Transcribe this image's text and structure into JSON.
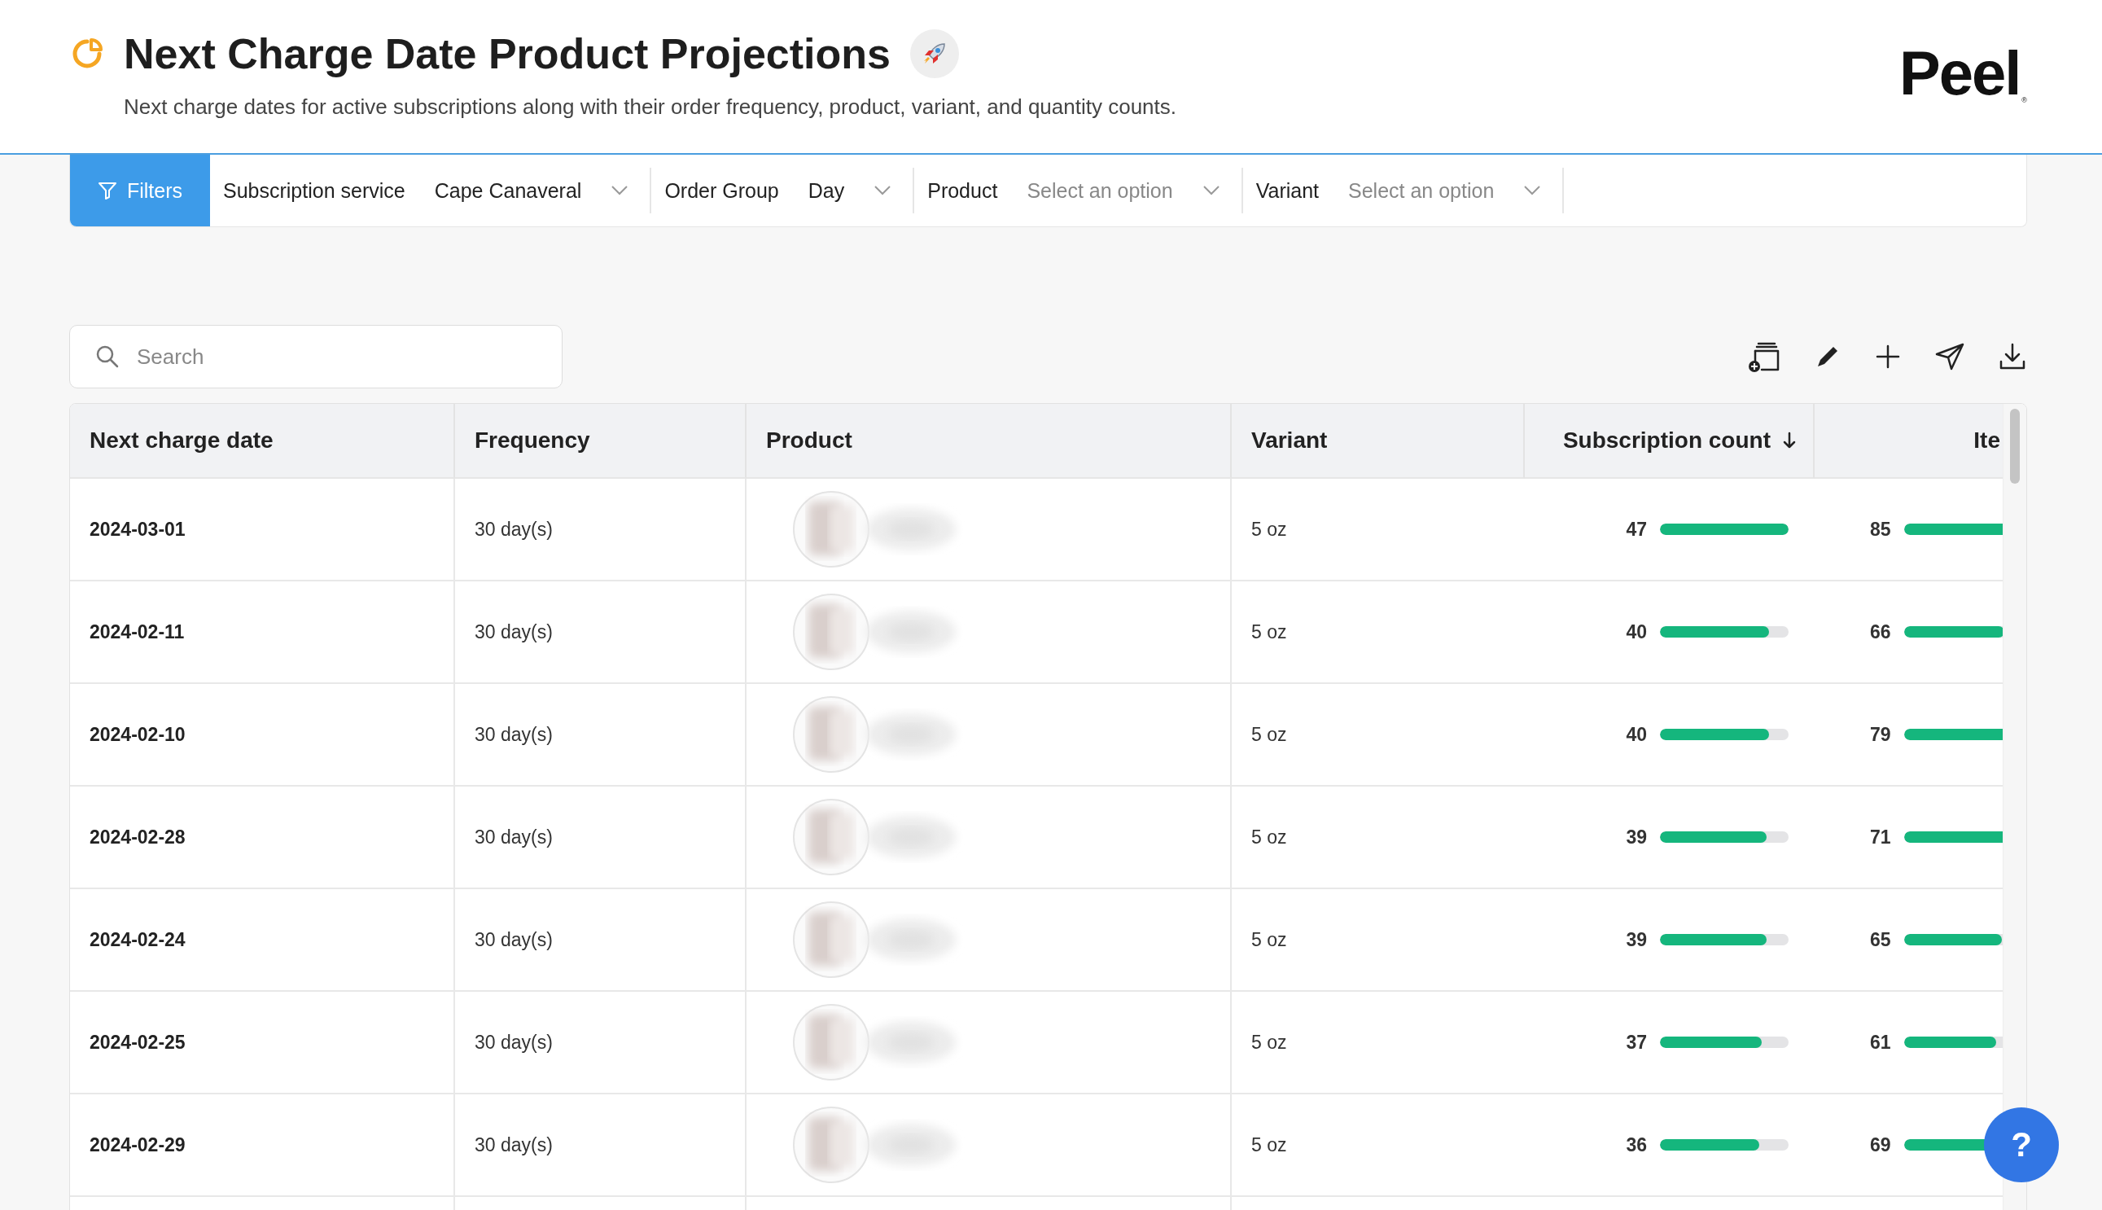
{
  "header": {
    "title": "Next Charge Date Product Projections",
    "subtitle": "Next charge dates for active subscriptions along with their order frequency, product, variant, and quantity counts.",
    "logo": "Peel",
    "logo_mark": "®"
  },
  "filters": {
    "button": "Filters",
    "items": [
      {
        "label": "Subscription service",
        "value": "Cape Canaveral"
      },
      {
        "label": "Order Group",
        "value": "Day"
      },
      {
        "label": "Product",
        "placeholder": "Select an option"
      },
      {
        "label": "Variant",
        "placeholder": "Select an option"
      }
    ]
  },
  "search": {
    "placeholder": "Search"
  },
  "table": {
    "columns": [
      {
        "label": "Next charge date",
        "kind": "text"
      },
      {
        "label": "Frequency",
        "kind": "text"
      },
      {
        "label": "Product",
        "kind": "text"
      },
      {
        "label": "Variant",
        "kind": "text"
      },
      {
        "label": "Subscription count",
        "kind": "text",
        "sort_descending": true
      },
      {
        "label": "Ite",
        "kind": "cut"
      }
    ],
    "rows": [
      {
        "date": "2024-03-01",
        "frequency": "30 day(s)",
        "variant": "5 oz",
        "subscriptions": {
          "value": "47",
          "level": 1.0
        },
        "items": {
          "value": "85",
          "level": 1.0
        }
      },
      {
        "date": "2024-02-11",
        "frequency": "30 day(s)",
        "variant": "5 oz",
        "subscriptions": {
          "value": "40",
          "level": 0.85
        },
        "items": {
          "value": "66",
          "level": 0.78
        }
      },
      {
        "date": "2024-02-10",
        "frequency": "30 day(s)",
        "variant": "5 oz",
        "subscriptions": {
          "value": "40",
          "level": 0.85
        },
        "items": {
          "value": "79",
          "level": 0.93
        }
      },
      {
        "date": "2024-02-28",
        "frequency": "30 day(s)",
        "variant": "5 oz",
        "subscriptions": {
          "value": "39",
          "level": 0.83
        },
        "items": {
          "value": "71",
          "level": 0.84
        }
      },
      {
        "date": "2024-02-24",
        "frequency": "30 day(s)",
        "variant": "5 oz",
        "subscriptions": {
          "value": "39",
          "level": 0.83
        },
        "items": {
          "value": "65",
          "level": 0.76
        }
      },
      {
        "date": "2024-02-25",
        "frequency": "30 day(s)",
        "variant": "5 oz",
        "subscriptions": {
          "value": "37",
          "level": 0.79
        },
        "items": {
          "value": "61",
          "level": 0.72
        }
      },
      {
        "date": "2024-02-29",
        "frequency": "30 day(s)",
        "variant": "5 oz",
        "subscriptions": {
          "value": "36",
          "level": 0.77
        },
        "items": {
          "value": "69",
          "level": 0.81
        }
      }
    ]
  },
  "help": {
    "label": "?"
  }
}
